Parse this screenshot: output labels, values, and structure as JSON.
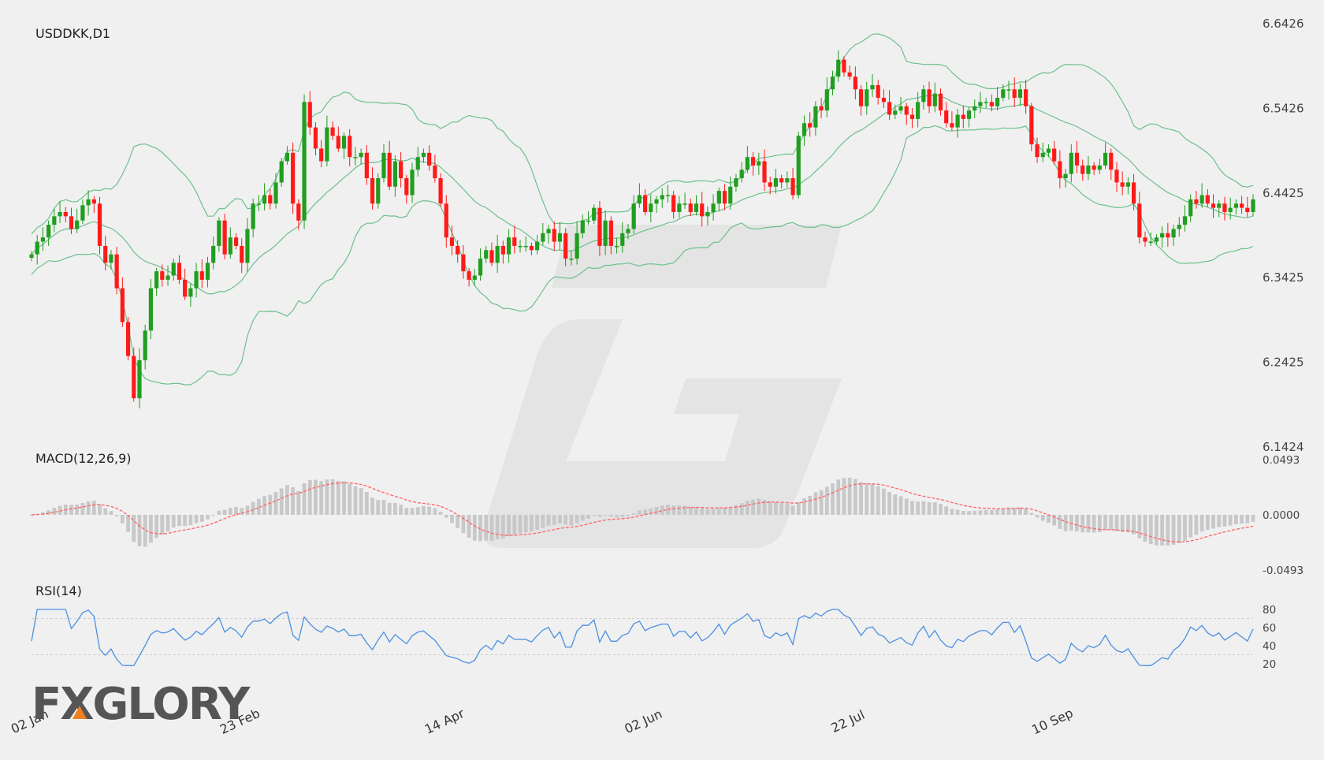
{
  "chart_data": [
    {
      "type": "candlestick",
      "title": "USDDKK,D1",
      "y_ticks": [
        "6.6426",
        "6.5426",
        "6.4425",
        "6.3425",
        "6.2425",
        "6.1424"
      ],
      "ylim": [
        6.1424,
        6.6426
      ],
      "x_ticks": [
        {
          "label": "02 Jan",
          "index": 0
        },
        {
          "label": "23 Feb",
          "index": 37
        },
        {
          "label": "14 Apr",
          "index": 73
        },
        {
          "label": "02 Jun",
          "index": 108
        },
        {
          "label": "22 Jul",
          "index": 144
        },
        {
          "label": "10 Sep",
          "index": 180
        }
      ],
      "close": [
        6.37,
        6.385,
        6.39,
        6.405,
        6.415,
        6.42,
        6.415,
        6.4,
        6.41,
        6.428,
        6.435,
        6.43,
        6.38,
        6.36,
        6.37,
        6.33,
        6.29,
        6.25,
        6.2,
        6.245,
        6.28,
        6.33,
        6.35,
        6.34,
        6.345,
        6.36,
        6.34,
        6.32,
        6.33,
        6.35,
        6.34,
        6.36,
        6.38,
        6.41,
        6.37,
        6.39,
        6.38,
        6.36,
        6.4,
        6.43,
        6.43,
        6.44,
        6.43,
        6.455,
        6.48,
        6.49,
        6.43,
        6.41,
        6.55,
        6.52,
        6.495,
        6.48,
        6.52,
        6.51,
        6.495,
        6.51,
        6.485,
        6.485,
        6.49,
        6.46,
        6.43,
        6.46,
        6.49,
        6.45,
        6.48,
        6.46,
        6.44,
        6.47,
        6.485,
        6.49,
        6.475,
        6.46,
        6.43,
        6.39,
        6.38,
        6.37,
        6.35,
        6.34,
        6.345,
        6.365,
        6.375,
        6.36,
        6.38,
        6.37,
        6.39,
        6.38,
        6.38,
        6.38,
        6.375,
        6.385,
        6.395,
        6.4,
        6.385,
        6.395,
        6.365,
        6.365,
        6.395,
        6.41,
        6.41,
        6.425,
        6.38,
        6.41,
        6.38,
        6.38,
        6.395,
        6.4,
        6.43,
        6.44,
        6.42,
        6.43,
        6.435,
        6.44,
        6.44,
        6.42,
        6.43,
        6.43,
        6.42,
        6.43,
        6.415,
        6.42,
        6.43,
        6.445,
        6.43,
        6.45,
        6.46,
        6.47,
        6.485,
        6.475,
        6.48,
        6.455,
        6.45,
        6.46,
        6.455,
        6.46,
        6.44,
        6.51,
        6.525,
        6.52,
        6.545,
        6.54,
        6.565,
        6.58,
        6.6,
        6.585,
        6.58,
        6.565,
        6.545,
        6.565,
        6.57,
        6.555,
        6.55,
        6.535,
        6.54,
        6.545,
        6.535,
        6.53,
        6.55,
        6.565,
        6.545,
        6.56,
        6.54,
        6.525,
        6.52,
        6.535,
        6.53,
        6.54,
        6.545,
        6.55,
        6.55,
        6.545,
        6.555,
        6.565,
        6.565,
        6.555,
        6.565,
        6.545,
        6.5,
        6.485,
        6.49,
        6.495,
        6.48,
        6.46,
        6.465,
        6.49,
        6.475,
        6.465,
        6.475,
        6.47,
        6.475,
        6.49,
        6.47,
        6.455,
        6.45,
        6.455,
        6.43,
        6.39,
        6.385,
        6.385,
        6.39,
        6.395,
        6.39,
        6.4,
        6.405,
        6.415,
        6.435,
        6.43,
        6.44,
        6.43,
        6.425,
        6.43,
        6.42,
        6.425,
        6.43,
        6.425,
        6.42,
        6.435
      ],
      "bollinger": {
        "period": 20,
        "deviations": 2
      },
      "series": [
        {
          "name": "up",
          "color": "#1f9e1f"
        },
        {
          "name": "down",
          "color": "#ff1a1a"
        },
        {
          "name": "bands",
          "color": "#6cc08b"
        }
      ]
    },
    {
      "type": "bar+line",
      "title": "MACD(12,26,9)",
      "y_ticks": [
        "0.0493",
        "0.0000",
        "-0.0493"
      ],
      "ylim": [
        -0.0493,
        0.0493
      ],
      "series": [
        {
          "name": "histogram",
          "color": "#c8c8c8"
        },
        {
          "name": "signal",
          "color": "#ff6464"
        }
      ]
    },
    {
      "type": "line",
      "title": "RSI(14)",
      "y_ticks": [
        "80",
        "60",
        "40",
        "20"
      ],
      "ylim": [
        20,
        80
      ],
      "levels": [
        70,
        30
      ],
      "series": [
        {
          "name": "rsi",
          "color": "#4a90e2"
        }
      ]
    }
  ],
  "logo": "FXGLORY"
}
